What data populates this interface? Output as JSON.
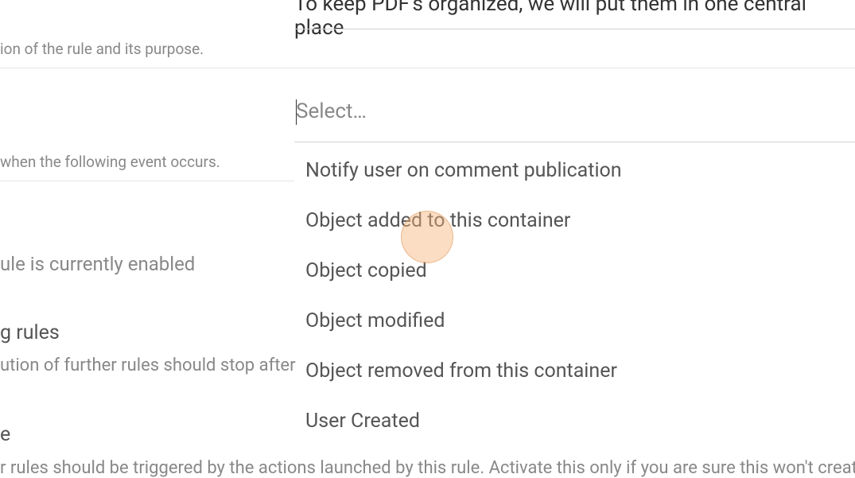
{
  "form": {
    "title_value": "To keep PDF's organized, we will put them in one central place",
    "description_hint": "ion of the rule and its purpose.",
    "select_placeholder": "Select…",
    "event_hint": "when the following event occurs.",
    "enabled_text": "ule is currently enabled",
    "stop_rules_heading": "g rules",
    "stop_rules_hint": "ution of further rules should stop after",
    "cascade_heading": "e",
    "cascade_hint": "r rules should be triggered by the actions launched by this rule. Activate this only if you are sure this won't create i"
  },
  "dropdown": {
    "options": [
      "Notify user on comment publication",
      "Object added to this container",
      "Object copied",
      "Object modified",
      "Object removed from this container",
      "User Created"
    ]
  }
}
